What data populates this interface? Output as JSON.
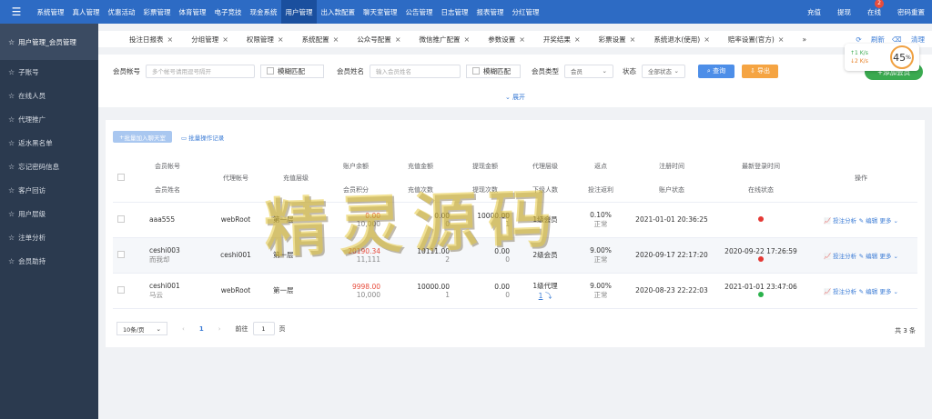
{
  "topnav": {
    "menu_icon": "menu-icon",
    "items": [
      "系统管理",
      "真人管理",
      "优惠活动",
      "彩票管理",
      "体育管理",
      "电子竞技",
      "现金系统",
      "用户管理",
      "出入款配置",
      "聊天室管理",
      "公告管理",
      "日志管理",
      "报表管理",
      "分红管理"
    ],
    "active_index": 7,
    "right": {
      "recharge": "充值",
      "withdraw": "提现",
      "online": "在线",
      "online_badge": "2",
      "pwd_reset": "密码重置"
    }
  },
  "sidebar": {
    "items": [
      "用户管理_会员管理",
      "子账号",
      "在线人员",
      "代理推广",
      "返水黑名单",
      "忘记密码信息",
      "客户回访",
      "用户层级",
      "注单分析",
      "会员助持"
    ]
  },
  "tabs": {
    "items": [
      "投注日报表",
      "分组管理",
      "权限管理",
      "系统配置",
      "公众号配置",
      "微信推广配置",
      "参数设置",
      "开奖结果",
      "彩票设置",
      "系统退水(使用)",
      "赔率设置(官方)"
    ],
    "more": "»",
    "refresh": "刷新",
    "clear": "清理"
  },
  "filter": {
    "account_label": "会员帐号",
    "account_placeholder": "多个帐号请用逗号隔开",
    "fuzzy1": "模糊匹配",
    "name_label": "会员姓名",
    "name_placeholder": "输入会员姓名",
    "fuzzy2": "模糊匹配",
    "type_label": "会员类型",
    "type_value": "会员",
    "status_label": "状态",
    "status_value": "全部状态",
    "search_btn": "查询",
    "export_btn": "导出",
    "expand": "展开",
    "add_btn": "添加会员"
  },
  "speed": {
    "up": "↑1 K/s",
    "down": "↓2 K/s",
    "percent": "45"
  },
  "batch": {
    "add_chat": "批量加入聊天室",
    "op_record": "批量操作记录"
  },
  "table": {
    "headers": {
      "account": "会员帐号",
      "name": "会员姓名",
      "agent": "代理帐号",
      "level": "充值层级",
      "balance": "账户余额",
      "points": "会员积分",
      "recharge_amt": "充值金额",
      "recharge_cnt": "充值次数",
      "withdraw_amt": "提现金额",
      "withdraw_cnt": "提现次数",
      "agent_level": "代理层级",
      "sub_count": "下级人数",
      "rebate": "返点",
      "bet_rebate": "投注返利",
      "reg_time": "注册时间",
      "acct_status": "账户状态",
      "last_login": "最新登录时间",
      "online_status": "在线状态",
      "ops": "操作"
    },
    "rows": [
      {
        "account": "aaa555",
        "name": "",
        "agent": "webRoot",
        "level": "第一层",
        "balance": "0.00",
        "points": "10,000",
        "recharge_amt": "0.00",
        "recharge_cnt": "0",
        "withdraw_amt": "10000.00",
        "withdraw_cnt": "1",
        "agent_level": "1级会员",
        "sub_count": "",
        "rebate": "0.10%",
        "status": "正常",
        "reg_time": "2021-01-01 20:36:25",
        "last_login": "",
        "online_color": "#e53935"
      },
      {
        "account": "ceshi003",
        "name": "而我却",
        "agent": "ceshi001",
        "level": "第一层",
        "balance": "20190.34",
        "points": "11,111",
        "recharge_amt": "10111.00",
        "recharge_cnt": "2",
        "withdraw_amt": "0.00",
        "withdraw_cnt": "0",
        "agent_level": "2级会员",
        "sub_count": "",
        "rebate": "9.00%",
        "status": "正常",
        "reg_time": "2020-09-17 22:17:20",
        "last_login": "2020-09-22 17:26:59",
        "online_color": "#e53935"
      },
      {
        "account": "ceshi001",
        "name": "马云",
        "agent": "webRoot",
        "level": "第一层",
        "balance": "9998.00",
        "points": "10,000",
        "recharge_amt": "10000.00",
        "recharge_cnt": "1",
        "withdraw_amt": "0.00",
        "withdraw_cnt": "0",
        "agent_level": "1级代理",
        "sub_count": "1",
        "rebate": "9.00%",
        "status": "正常",
        "reg_time": "2020-08-23 22:22:03",
        "last_login": "2021-01-01 23:47:06",
        "online_color": "#2bb24c"
      }
    ],
    "ops": {
      "analysis": "投注分析",
      "edit": "编辑",
      "more": "更多"
    }
  },
  "pager": {
    "page_size": "10条/页",
    "page": "1",
    "goto": "前往",
    "goto_value": "1",
    "page_unit": "页",
    "total": "共 3 条"
  },
  "watermark": "精灵源码"
}
